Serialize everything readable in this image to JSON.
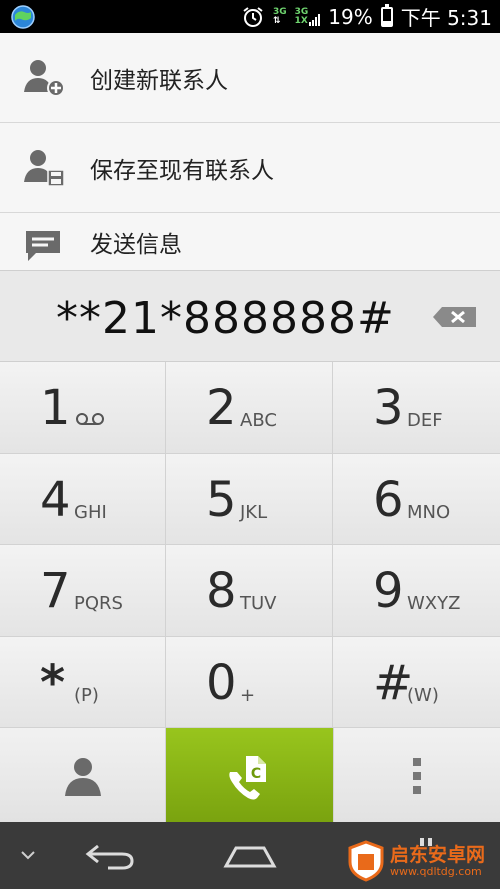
{
  "status_bar": {
    "network_1": "3G",
    "network_2": "3G",
    "network_2_sub": "1X",
    "battery_percent": "19%",
    "time": "下午 5:31"
  },
  "menu": {
    "items": [
      {
        "label": "创建新联系人",
        "icon": "add-contact-icon"
      },
      {
        "label": "保存至现有联系人",
        "icon": "save-contact-icon"
      },
      {
        "label": "发送信息",
        "icon": "message-icon"
      }
    ]
  },
  "dialer": {
    "number": "**21*888888#",
    "keys": [
      {
        "digit": "1",
        "letters": ""
      },
      {
        "digit": "2",
        "letters": "ABC"
      },
      {
        "digit": "3",
        "letters": "DEF"
      },
      {
        "digit": "4",
        "letters": "GHI"
      },
      {
        "digit": "5",
        "letters": "JKL"
      },
      {
        "digit": "6",
        "letters": "MNO"
      },
      {
        "digit": "7",
        "letters": "PQRS"
      },
      {
        "digit": "8",
        "letters": "TUV"
      },
      {
        "digit": "9",
        "letters": "WXYZ"
      },
      {
        "digit": "*",
        "letters": "(P)"
      },
      {
        "digit": "0",
        "letters": "+"
      },
      {
        "digit": "#",
        "letters": "(W)"
      }
    ]
  },
  "call_badge": "C",
  "watermark": {
    "title": "启东安卓网",
    "url": "www.qdltdg.com"
  },
  "colors": {
    "call_green": "#8bb817",
    "nav_bg": "#3a3a3a",
    "watermark_orange": "#e96a1a"
  }
}
